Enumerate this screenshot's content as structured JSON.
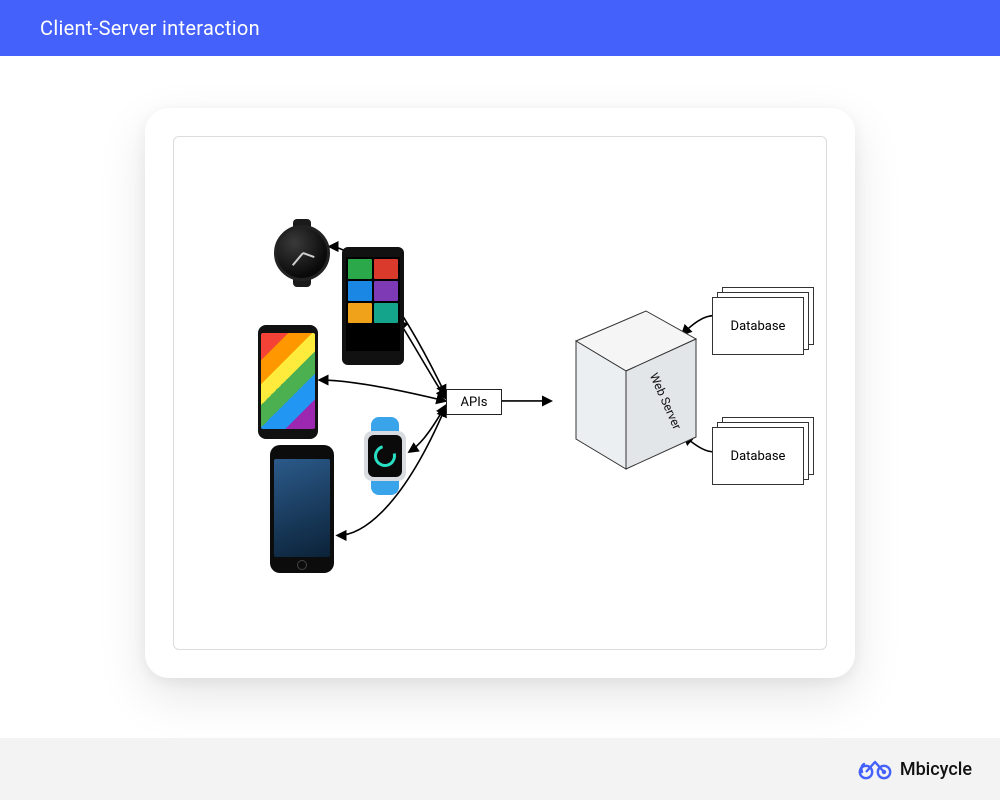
{
  "header": {
    "title": "Client-Server interaction"
  },
  "diagram": {
    "apis_label": "APIs",
    "server_label": "Web Server",
    "database_label_top": "Database",
    "database_label_bottom": "Database",
    "clients": {
      "watch_round": "smartwatch-round",
      "phone_tiles": "phone-windows-tiles",
      "phone_android": "phone-android",
      "watch_square": "smartwatch-square-blue",
      "phone_iphone": "phone-iphone"
    }
  },
  "brand": {
    "name": "Mbicycle"
  },
  "colors": {
    "header_bg": "#4461fb",
    "footer_bg": "#f3f3f3",
    "brand_accent": "#4461fb"
  }
}
